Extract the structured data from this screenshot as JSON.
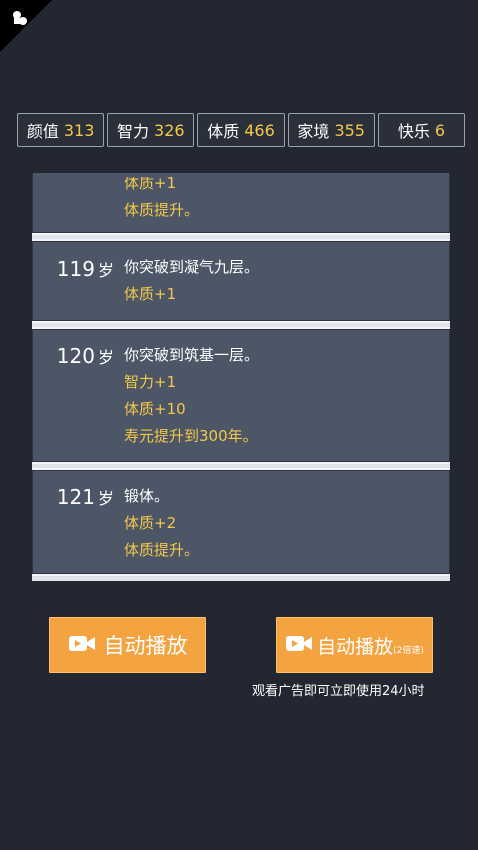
{
  "stats": [
    {
      "label": "颜值",
      "value": "313"
    },
    {
      "label": "智力",
      "value": "326"
    },
    {
      "label": "体质",
      "value": "466"
    },
    {
      "label": "家境",
      "value": "355"
    },
    {
      "label": "快乐",
      "value": "6"
    }
  ],
  "log": {
    "partial_entry": {
      "lines": [
        "体质+1",
        "体质提升。"
      ]
    },
    "entries": [
      {
        "age": "119",
        "unit": "岁",
        "event": "你突破到凝气九层。",
        "effects": [
          "体质+1"
        ]
      },
      {
        "age": "120",
        "unit": "岁",
        "event": "你突破到筑基一层。",
        "effects": [
          "智力+1",
          "体质+10",
          "寿元提升到300年。"
        ]
      },
      {
        "age": "121",
        "unit": "岁",
        "event": "锻体。",
        "effects": [
          "体质+2",
          "体质提升。"
        ]
      }
    ]
  },
  "buttons": {
    "autoplay_label": "自动播放",
    "autoplay2_label": "自动播放",
    "autoplay2_suffix": "(2倍速)"
  },
  "ad_note": "观看广告即可立即使用24小时",
  "icons": {
    "corner": "chess-piece-icon",
    "button": "video-camera-icon"
  }
}
